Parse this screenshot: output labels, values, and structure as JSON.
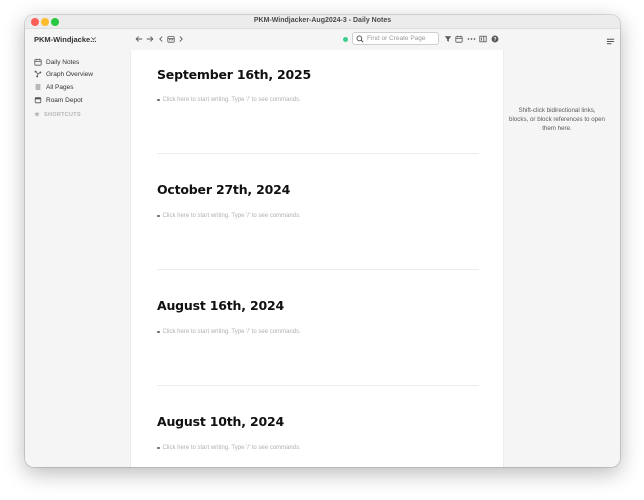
{
  "window": {
    "title": "PKM-Windjacker-Aug2024-3 - Daily Notes"
  },
  "sidebar": {
    "graph_name": "PKM-Windjacke...",
    "items": [
      {
        "label": "Daily Notes",
        "icon": "calendar-icon"
      },
      {
        "label": "Graph Overview",
        "icon": "graph-icon"
      },
      {
        "label": "All Pages",
        "icon": "list-icon"
      },
      {
        "label": "Roam Depot",
        "icon": "depot-icon"
      }
    ],
    "shortcuts_label": "SHORTCUTS"
  },
  "toolbar": {
    "search_placeholder": "Find or Create Page",
    "sync_color": "#3ecf8e"
  },
  "daily_notes": [
    {
      "date": "September 16th, 2025",
      "placeholder": "Click here to start writing. Type '/' to see commands."
    },
    {
      "date": "October 27th, 2024",
      "placeholder": "Click here to start writing. Type '/' to see commands."
    },
    {
      "date": "August 16th, 2024",
      "placeholder": "Click here to start writing. Type '/' to see commands."
    },
    {
      "date": "August 10th, 2024",
      "placeholder": "Click here to start writing. Type '/' to see commands."
    }
  ],
  "right_sidebar": {
    "hint": "Shift-click bidirectional links, blocks, or block references to open them here."
  }
}
